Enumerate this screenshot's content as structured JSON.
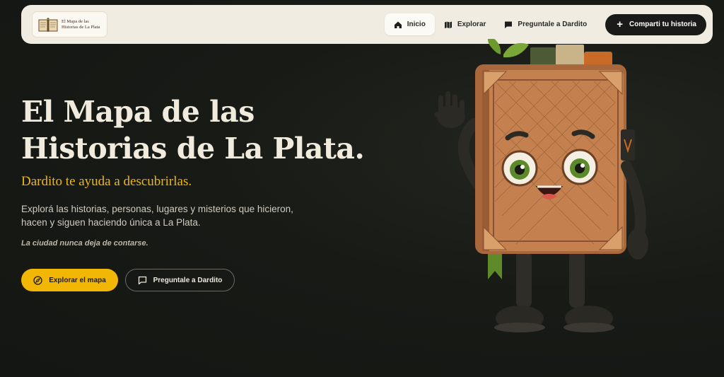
{
  "nav": {
    "logo_line1": "El Mapa de las",
    "logo_line2": "Historias de La Plata",
    "links": [
      {
        "label": "Inicio",
        "icon": "home-icon",
        "active": true
      },
      {
        "label": "Explorar",
        "icon": "map-icon",
        "active": false
      },
      {
        "label": "Preguntale a Dardito",
        "icon": "chat-icon",
        "active": false
      }
    ],
    "cta_label": "Comparti tu historia"
  },
  "hero": {
    "title_line1": "El Mapa de las",
    "title_line2": "Historias de La Plata.",
    "subtitle": "Dardito te ayuda a descubrirlas.",
    "description": "Explorá las historias, personas, lugares y misterios que hicieron, hacen y siguen haciendo única a La Plata.",
    "tagline": "La ciudad nunca deja de contarse.",
    "primary_button": "Explorar el mapa",
    "secondary_button": "Preguntale a Dardito"
  },
  "colors": {
    "accent": "#f2b705",
    "background": "#161814",
    "nav_background": "#f1ece1"
  },
  "mascot": {
    "name": "book-mascot-illustration"
  }
}
